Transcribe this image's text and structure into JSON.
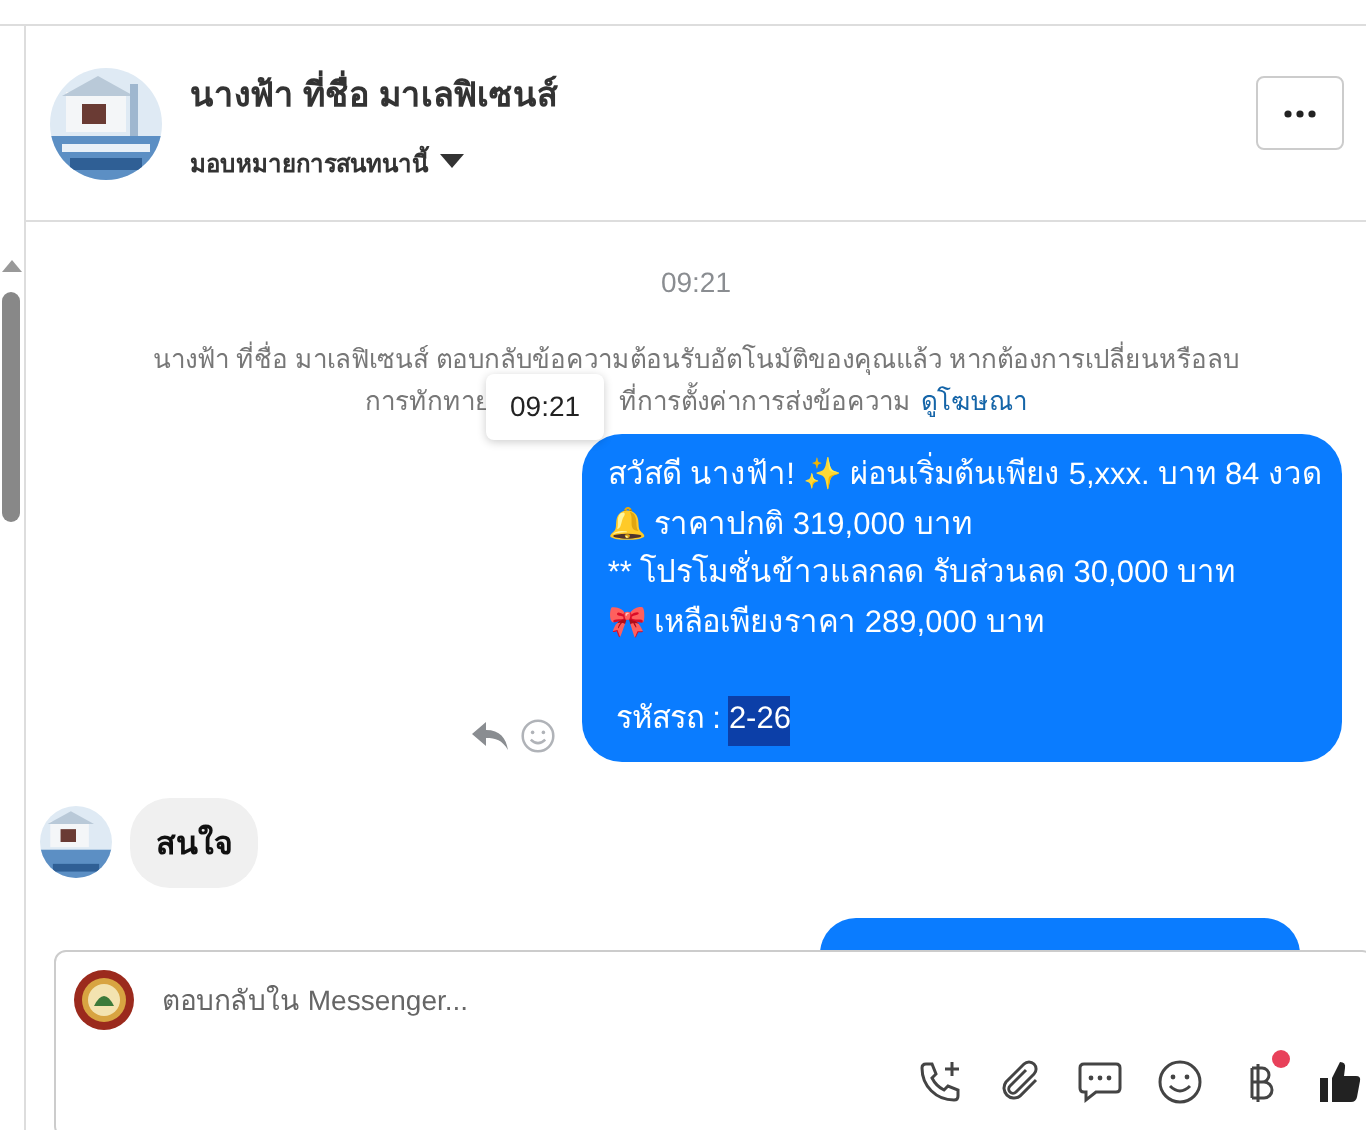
{
  "header": {
    "title": "นางฟ้า ที่ชื่อ มาเลฟิเซนส์",
    "subtitle": "มอบหมายการสนทนานี้"
  },
  "timestamp": "09:21",
  "notice": {
    "line_1": "นางฟ้า ที่ชื่อ มาเลฟิเซนส์ ตอบกลับข้อความต้อนรับอัตโนมัติของคุณแล้ว หากต้องการเปลี่ยนหรือลบ",
    "line_2_start": "การทักทาย",
    "line_2_end": "ที่การตั้งค่าการส่งข้อความ",
    "link": "ดูโฆษณา"
  },
  "tooltip": "09:21",
  "outgoing_message": {
    "lines": [
      "สวัสดี นางฟ้า! ✨  ผ่อนเริ่มต้นเพียง 5,xxx. บาท 84 งวด",
      "🔔 ราคาปกติ 319,000 บาท",
      "** โปรโมชั่นข้าวแลกลด รับส่วนลด 30,000 บาท",
      "🎀  เหลือเพียงราคา 289,000 บาท"
    ],
    "code_label": "รหัสรถ :",
    "code_value": "2-26",
    "code_selected": true
  },
  "incoming_message": {
    "text": "สนใจ"
  },
  "composer": {
    "placeholder": "ตอบกลับใน Messenger...",
    "payment_badge": true
  }
}
